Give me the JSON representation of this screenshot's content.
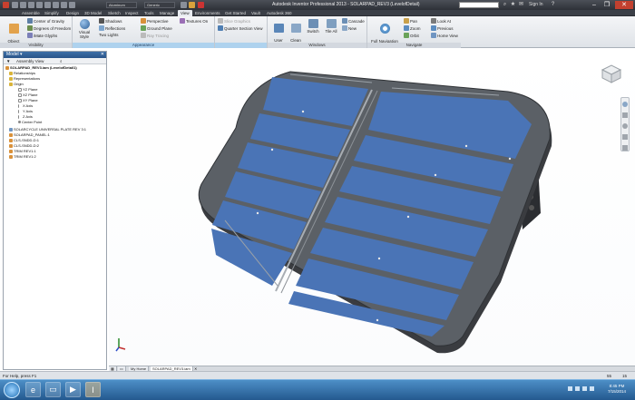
{
  "window": {
    "title": "Autodesk Inventor Professional 2013 - SOLARPAD_REV3 (LevelofDetail)",
    "help_search_placeholder": "",
    "sign_in": "Sign In",
    "minimize": "–",
    "restore": "❐",
    "close": "✕"
  },
  "quick_access": {
    "appearance_combo": "Aluminum",
    "material_combo": "Generic"
  },
  "tabs": [
    "Assemble",
    "Simplify",
    "Design",
    "3D Model",
    "Sketch",
    "Inspect",
    "Tools",
    "Manage",
    "View",
    "Environments",
    "Get Started",
    "Vault",
    "Autodesk 360"
  ],
  "active_tab": "View",
  "ribbon": {
    "visibility": {
      "label": "Visibility",
      "object_visibility": "Object\nVisibility",
      "center_of_gravity": "Center of Gravity",
      "degrees_of_freedom": "Degrees of Freedom",
      "ilogic_glyphs": "iMate Glyphs"
    },
    "appearance": {
      "label": "Appearance",
      "visual_style": "Visual Style",
      "shadows": "Shadows",
      "reflections": "Reflections",
      "two_lights": "Two Lights",
      "perspective": "Perspective",
      "ground_plane": "Ground Plane",
      "ray_tracing": "Ray Tracing",
      "textures_on": "Textures On",
      "slice_graphics": "Slice Graphics",
      "quarter_section_view": "Quarter Section View"
    },
    "windows": {
      "label": "Windows",
      "user_interface": "User\nInterface",
      "clean_screen": "Clean\nScreen",
      "switch": "Switch",
      "tile_all": "Tile All",
      "cascade": "Cascade",
      "new": "New"
    },
    "navigate": {
      "label": "Navigate",
      "full_navigation_wheel": "Full Navigation\nWheel",
      "pan": "Pan",
      "zoom": "Zoom",
      "orbit": "Orbit",
      "look_at": "Look At",
      "previous": "Previous",
      "home_view": "Home View"
    }
  },
  "browser": {
    "title": "Model ▾",
    "view_mode": "Assembly View",
    "items": [
      {
        "label": "SOLARPAD_REV3.iam (LevelofDetail1)",
        "level": 0
      },
      {
        "label": "Relationships",
        "level": 1
      },
      {
        "label": "Representations",
        "level": 1
      },
      {
        "label": "Origin",
        "level": 1
      },
      {
        "label": "YZ Plane",
        "level": 2
      },
      {
        "label": "XZ Plane",
        "level": 2
      },
      {
        "label": "XY Plane",
        "level": 2
      },
      {
        "label": "X Axis",
        "level": 2
      },
      {
        "label": "Y Axis",
        "level": 2
      },
      {
        "label": "Z Axis",
        "level": 2
      },
      {
        "label": "Center Point",
        "level": 2
      },
      {
        "label": "SOLARCYCLE UNIVERSAL PLATE REV 3:1",
        "level": 1
      },
      {
        "label": "SOLARPAD_PANEL:1",
        "level": 1
      },
      {
        "label": "CLS-SNDD-D:1",
        "level": 1
      },
      {
        "label": "CLS-SNDD-D:2",
        "level": 1
      },
      {
        "label": "TRIM REV1:1",
        "level": 1
      },
      {
        "label": "TRIM REV1:2",
        "level": 1
      }
    ]
  },
  "doc_tabs": {
    "home": "My Home",
    "active": "SOLARPAD_REV3.iam"
  },
  "status": {
    "help_text": "For Help, press F1",
    "count_a": "55",
    "count_b": "15"
  },
  "taskbar": {
    "time": "8:45 PM",
    "date": "7/15/2014"
  },
  "colors": {
    "accent": "#2a5489",
    "panel_blue": "#4a74b6",
    "frame_gray": "#555a60"
  }
}
